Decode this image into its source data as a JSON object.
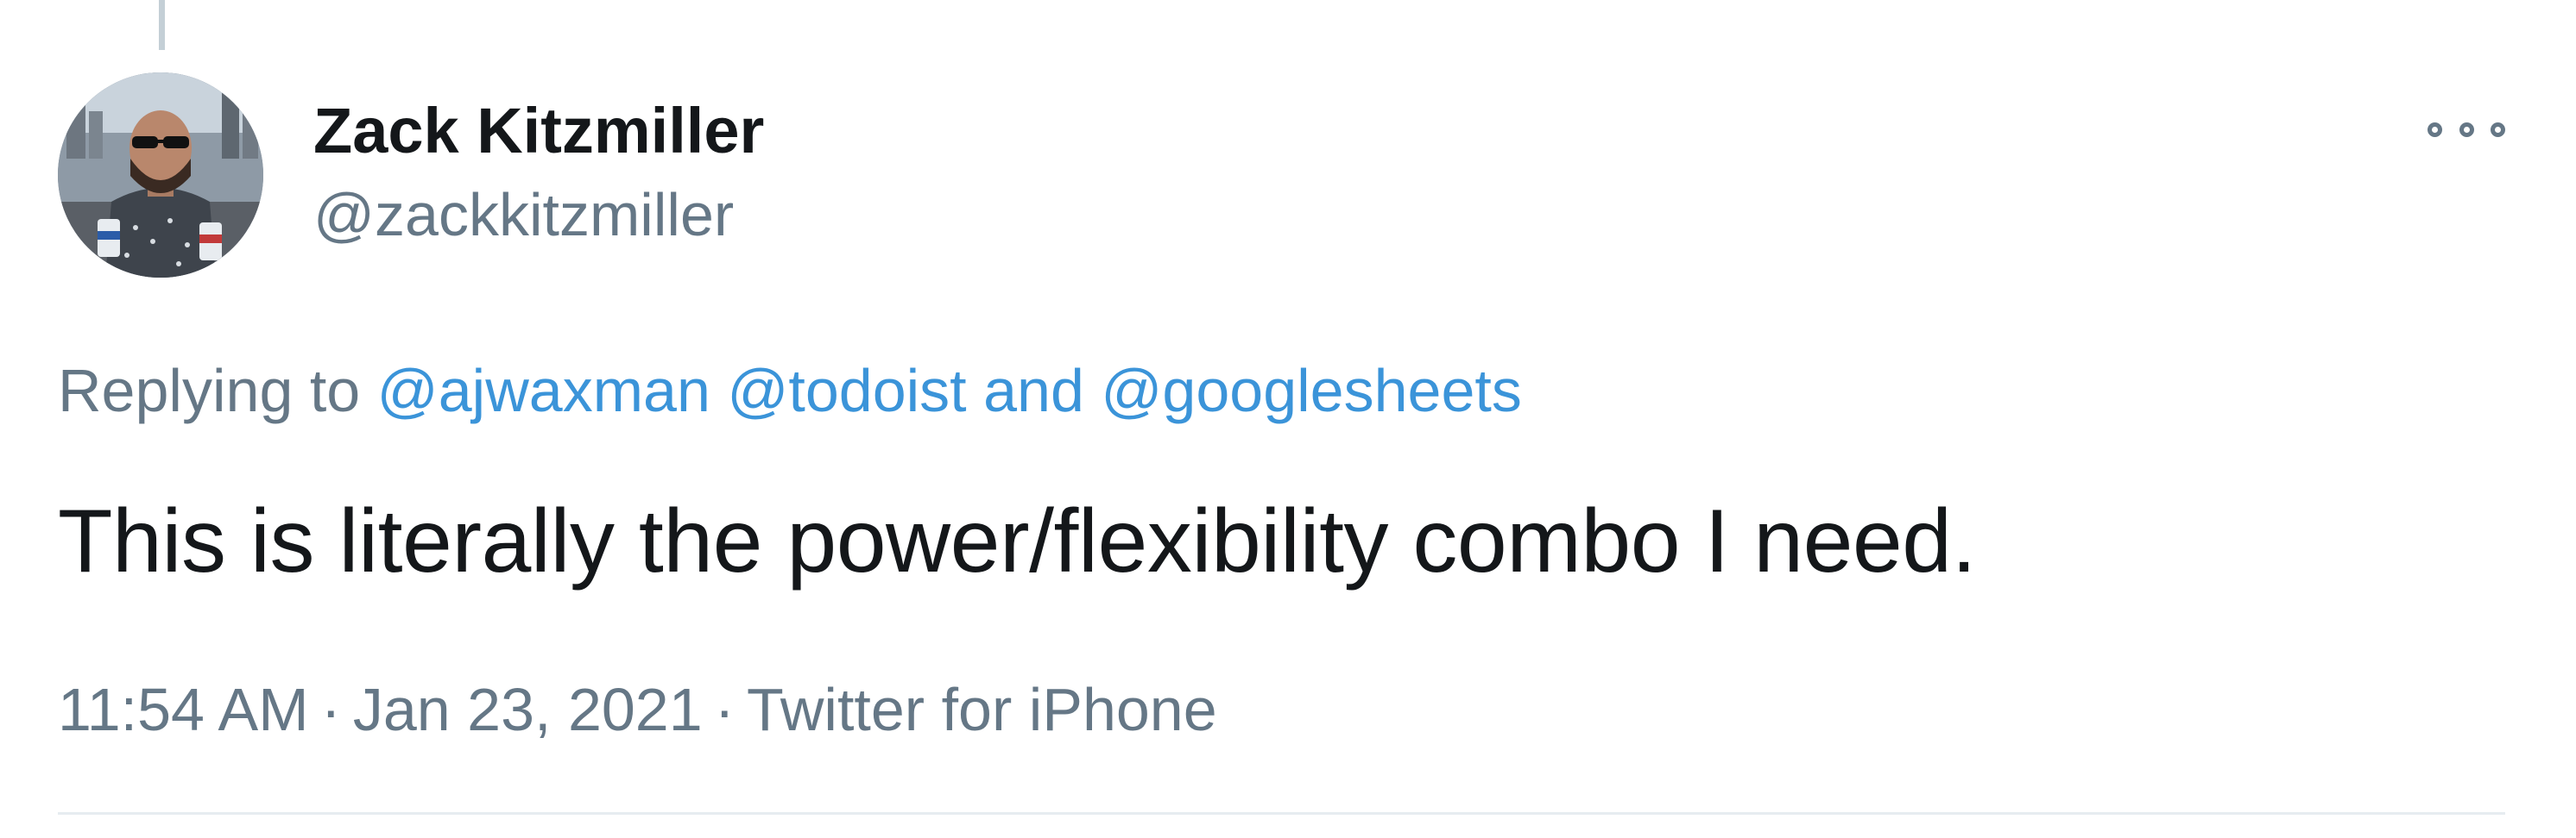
{
  "tweet": {
    "author": {
      "display_name": "Zack Kitzmiller",
      "handle": "@zackkitzmiller",
      "avatar_icon": "profile-photo"
    },
    "more_icon": "more-options-icon",
    "reply_context": {
      "prefix": "Replying to",
      "mentions": [
        "@ajwaxman",
        "@todoist",
        "@googlesheets"
      ],
      "conjunction": "and"
    },
    "text": "This is literally the power/flexibility combo I need.",
    "meta": {
      "time": "11:54 AM",
      "date": "Jan 23, 2021",
      "source": "Twitter for iPhone",
      "separator": "·"
    }
  },
  "colors": {
    "primary_text": "#14171a",
    "secondary_text": "#657786",
    "link": "#3b94d9",
    "divider": "#e6ecf0",
    "thread_line": "#c4cfd6"
  }
}
